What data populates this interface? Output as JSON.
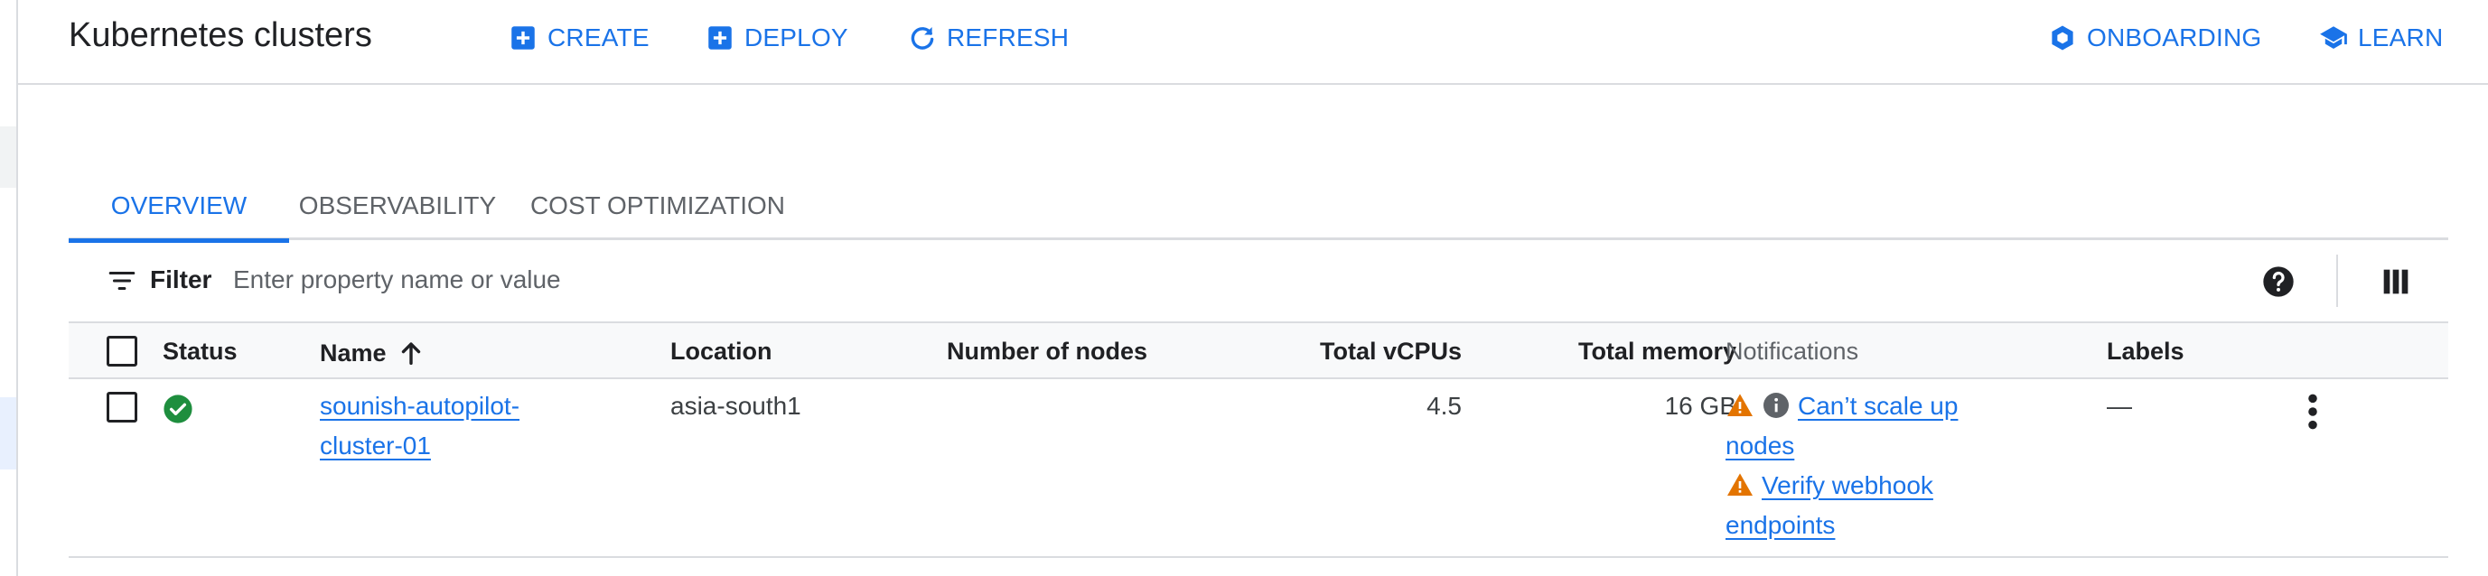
{
  "header": {
    "title": "Kubernetes clusters",
    "actions": {
      "create": "CREATE",
      "deploy": "DEPLOY",
      "refresh": "REFRESH",
      "onboarding": "ONBOARDING",
      "learn": "LEARN"
    }
  },
  "tabs": [
    {
      "label": "OVERVIEW",
      "active": true
    },
    {
      "label": "OBSERVABILITY",
      "active": false
    },
    {
      "label": "COST OPTIMIZATION",
      "active": false
    }
  ],
  "filter": {
    "label": "Filter",
    "placeholder": "Enter property name or value"
  },
  "table": {
    "columns": {
      "status": "Status",
      "name": "Name",
      "location": "Location",
      "nodes": "Number of nodes",
      "vcpus": "Total vCPUs",
      "memory": "Total memory",
      "notifications": "Notifications",
      "labels": "Labels"
    },
    "sort": {
      "column": "Name",
      "direction": "ascending"
    },
    "rows": [
      {
        "status": "ok",
        "name_line1": "sounish-autopilot-",
        "name_line2": "cluster-01",
        "location": "asia-south1",
        "nodes": "",
        "vcpus": "4.5",
        "memory": "16 GB",
        "notifications": [
          {
            "line1": "Can’t scale up",
            "line2": "nodes",
            "icons": [
              "warning-icon",
              "info-icon"
            ]
          },
          {
            "line1": "Verify webhook",
            "line2": "endpoints",
            "icons": [
              "warning-icon"
            ]
          }
        ],
        "labels": "—"
      }
    ]
  },
  "colors": {
    "accent": "#1a73e8",
    "success": "#1e8e3e",
    "warning": "#e37400",
    "divider": "#dadce0",
    "header_bg": "#f8f9fa"
  }
}
